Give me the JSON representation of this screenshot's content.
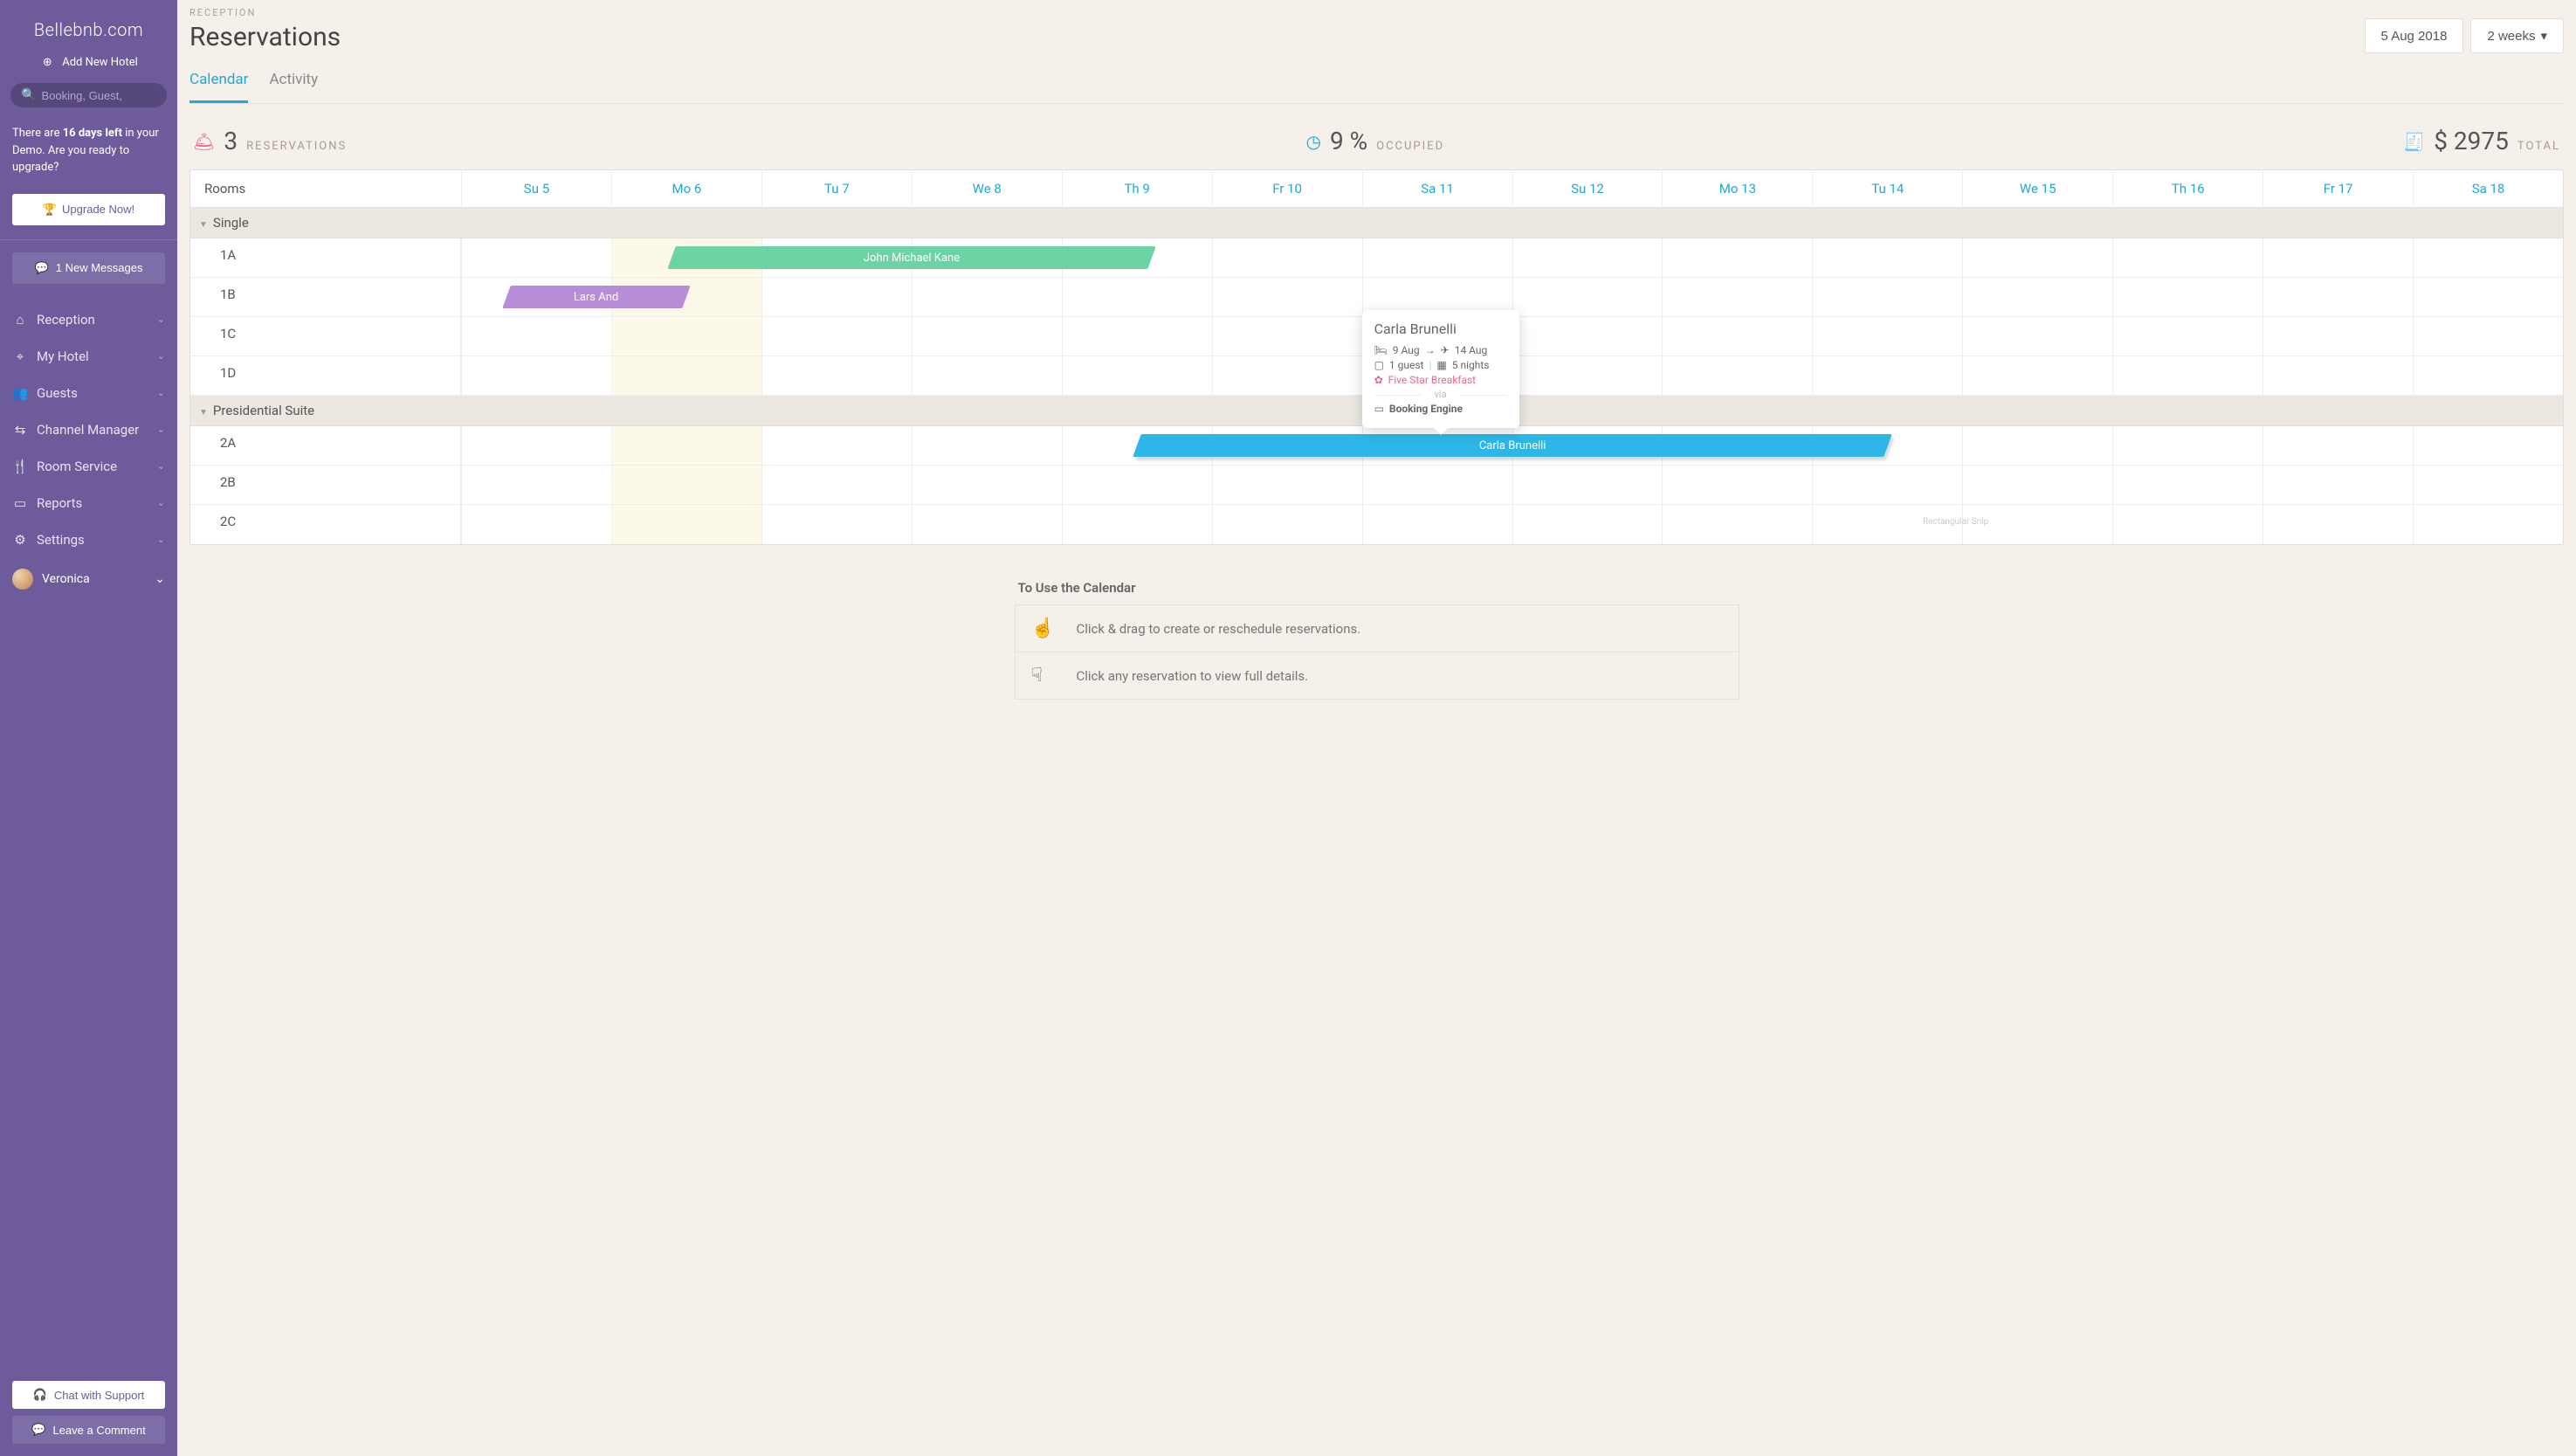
{
  "brand": "Bellebnb.com",
  "add_hotel": "Add New Hotel",
  "search_placeholder": "Booking, Guest,",
  "demo_prefix": "There are ",
  "demo_days": "16 days left",
  "demo_suffix": " in your Demo. Are you ready to upgrade?",
  "upgrade": "Upgrade Now!",
  "messages": "1 New Messages",
  "nav": [
    {
      "icon": "⌂",
      "label": "Reception"
    },
    {
      "icon": "⌖",
      "label": "My Hotel"
    },
    {
      "icon": "👥",
      "label": "Guests"
    },
    {
      "icon": "⇆",
      "label": "Channel Manager"
    },
    {
      "icon": "🍴",
      "label": "Room Service"
    },
    {
      "icon": "▭",
      "label": "Reports"
    },
    {
      "icon": "⚙",
      "label": "Settings"
    }
  ],
  "user": "Veronica",
  "chat": "Chat with Support",
  "comment": "Leave a Comment",
  "crumb": "RECEPTION",
  "title": "Reservations",
  "date_btn": "5 Aug 2018",
  "range_btn": "2 weeks",
  "tabs": {
    "calendar": "Calendar",
    "activity": "Activity"
  },
  "stats": {
    "res_num": "3",
    "res_lbl": "RESERVATIONS",
    "occ_num": "9 %",
    "occ_lbl": "OCCUPIED",
    "tot_num": "$ 2975",
    "tot_lbl": "TOTAL"
  },
  "rooms_header": "Rooms",
  "days": [
    "Su 5",
    "Mo 6",
    "Tu 7",
    "We 8",
    "Th 9",
    "Fr 10",
    "Sa 11",
    "Su 12",
    "Mo 13",
    "Tu 14",
    "We 15",
    "Th 16",
    "Fr 17",
    "Sa 18"
  ],
  "groups": [
    {
      "name": "Single",
      "rooms": [
        "1A",
        "1B",
        "1C",
        "1D"
      ]
    },
    {
      "name": "Presidential Suite",
      "rooms": [
        "2A",
        "2B",
        "2C"
      ]
    }
  ],
  "reservations": {
    "kane": "John Michael Kane",
    "lars": "Lars And",
    "carla": "Carla Brunelli"
  },
  "tooltip": {
    "name": "Carla Brunelli",
    "in": "9 Aug",
    "out": "14 Aug",
    "guests": "1 guest",
    "nights": "5 nights",
    "meal": "Five Star Breakfast",
    "via": "via",
    "source": "Booking Engine"
  },
  "help": {
    "title": "To Use the Calendar",
    "row1": "Click & drag to create or reschedule reservations.",
    "row2": "Click any reservation to view full details."
  },
  "snip": "Rectangular Snip"
}
